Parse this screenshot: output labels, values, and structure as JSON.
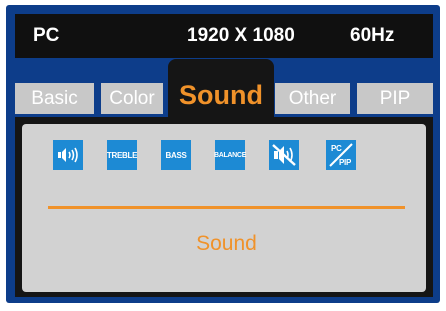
{
  "header": {
    "source": "PC",
    "resolution": "1920 X 1080",
    "refresh": "60Hz"
  },
  "tabs": [
    {
      "label": "Basic"
    },
    {
      "label": "Color"
    },
    {
      "label": "Sound",
      "active": true
    },
    {
      "label": "Other"
    },
    {
      "label": "PIP"
    }
  ],
  "icons": [
    {
      "name": "volume-icon",
      "text": ""
    },
    {
      "name": "treble-icon",
      "text": "TREBLE"
    },
    {
      "name": "bass-icon",
      "text": "BASS"
    },
    {
      "name": "balance-icon",
      "text": "BALANCE"
    },
    {
      "name": "mute-icon",
      "text": ""
    },
    {
      "name": "pc-pip-icon",
      "top": "PC",
      "bottom": "PIP"
    }
  ],
  "panel": {
    "selected_label": "Sound"
  },
  "colors": {
    "frame": "#0d3d8a",
    "accent": "#f0922a",
    "icon": "#1d8ad4",
    "tab_inactive": "#c8c8c8",
    "panel_bg": "#d2d2d2"
  }
}
